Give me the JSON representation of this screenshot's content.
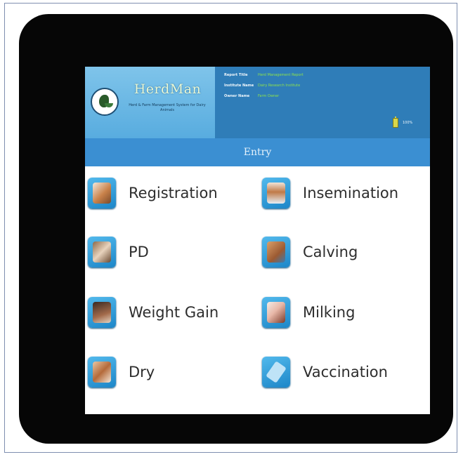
{
  "app": {
    "name": "HerdMan",
    "tagline": "Herd & Farm Management System for Dairy Animals",
    "section_title": "Entry"
  },
  "header_info": [
    {
      "label": "Report Title",
      "value": "Herd Management Report"
    },
    {
      "label": "Institute Name",
      "value": "Dairy Research Institute"
    },
    {
      "label": "Owner Name",
      "value": "Farm Owner"
    }
  ],
  "battery": {
    "label": "100%"
  },
  "menu": [
    {
      "label": "Registration",
      "icon": "cow-registration-icon"
    },
    {
      "label": "Insemination",
      "icon": "insemination-icon"
    },
    {
      "label": "PD",
      "icon": "pregnancy-diagnosis-icon"
    },
    {
      "label": "Calving",
      "icon": "calving-icon"
    },
    {
      "label": "Weight Gain",
      "icon": "weight-gain-icon"
    },
    {
      "label": "Milking",
      "icon": "milking-icon"
    },
    {
      "label": "Dry",
      "icon": "dry-cow-icon"
    },
    {
      "label": "Vaccination",
      "icon": "vaccination-syringe-icon"
    }
  ],
  "colors": {
    "header_bg": "#2f7db8",
    "brand_bg": "#6bb9e4",
    "titlebar_bg": "#3b8fd2",
    "icon_bg": "#2a9ad8",
    "info_value": "#8fe34a"
  }
}
